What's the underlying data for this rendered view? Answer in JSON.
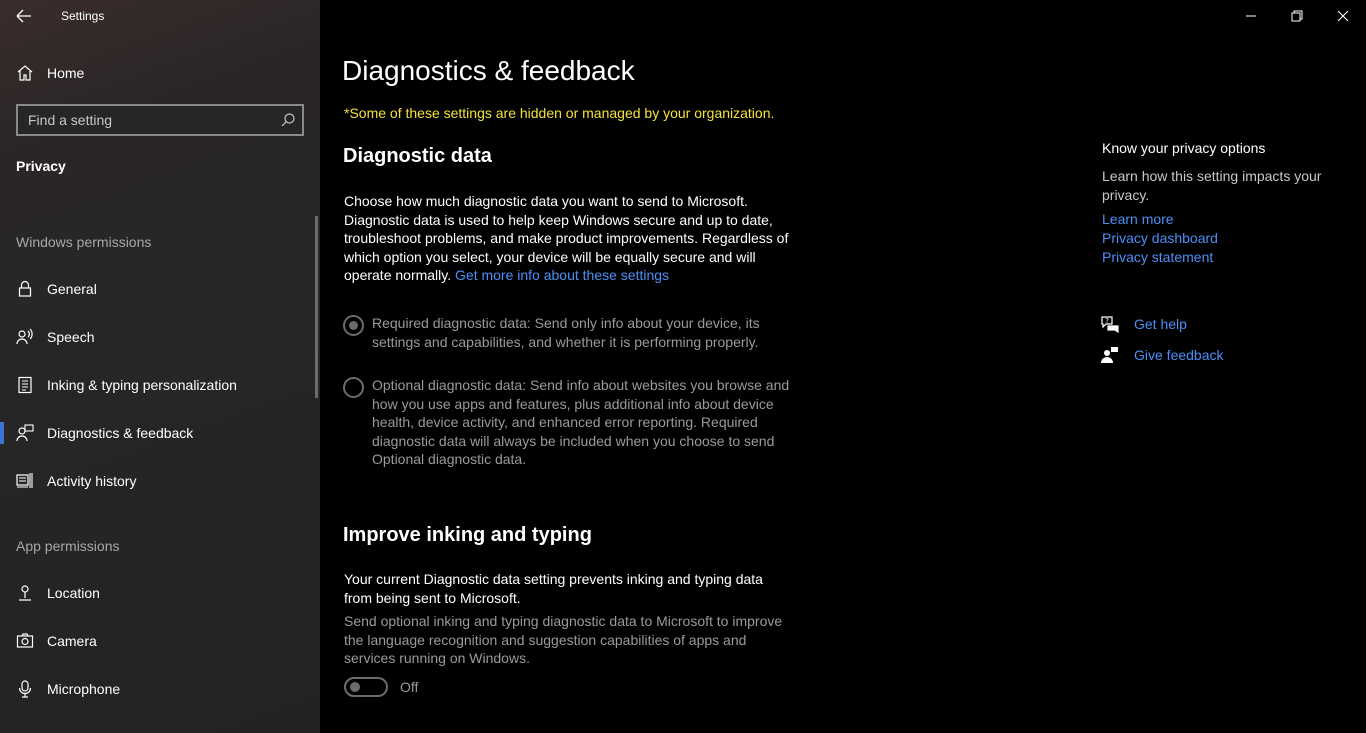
{
  "window": {
    "app_title": "Settings"
  },
  "sidebar": {
    "home_label": "Home",
    "search_placeholder": "Find a setting",
    "section": "Privacy",
    "windows_permissions_label": "Windows permissions",
    "windows_items": [
      {
        "label": "General",
        "icon": "lock-icon"
      },
      {
        "label": "Speech",
        "icon": "speech-icon"
      },
      {
        "label": "Inking & typing personalization",
        "icon": "inking-icon"
      },
      {
        "label": "Diagnostics & feedback",
        "icon": "diagnostics-icon",
        "active": true
      },
      {
        "label": "Activity history",
        "icon": "activity-icon"
      }
    ],
    "app_permissions_label": "App permissions",
    "app_items": [
      {
        "label": "Location",
        "icon": "location-icon"
      },
      {
        "label": "Camera",
        "icon": "camera-icon"
      },
      {
        "label": "Microphone",
        "icon": "microphone-icon"
      }
    ]
  },
  "main": {
    "title": "Diagnostics & feedback",
    "org_notice": "*Some of these settings are hidden or managed by your organization.",
    "diagnostic": {
      "heading": "Diagnostic data",
      "description": "Choose how much diagnostic data you want to send to Microsoft. Diagnostic data is used to help keep Windows secure and up to date, troubleshoot problems, and make product improvements. Regardless of which option you select, your device will be equally secure and will operate normally.",
      "more_info_link": "Get more info about these settings",
      "required_option": "Required diagnostic data: Send only info about your device, its settings and capabilities, and whether it is performing properly.",
      "optional_option": "Optional diagnostic data: Send info about websites you browse and how you use apps and features, plus additional info about device health, device activity, and enhanced error reporting. Required diagnostic data will always be included when you choose to send Optional diagnostic data.",
      "selected": "required"
    },
    "inking": {
      "heading": "Improve inking and typing",
      "warning": "Your current Diagnostic data setting prevents inking and typing data from being sent to Microsoft.",
      "description": "Send optional inking and typing diagnostic data to Microsoft to improve the language recognition and suggestion capabilities of apps and services running on Windows.",
      "toggle_state": "Off"
    }
  },
  "right_panel": {
    "title": "Know your privacy options",
    "description": "Learn how this setting impacts your privacy.",
    "links": [
      "Learn more",
      "Privacy dashboard",
      "Privacy statement"
    ],
    "get_help": "Get help",
    "give_feedback": "Give feedback"
  },
  "colors": {
    "accent": "#3a73d6",
    "link": "#4c8ff5",
    "warning": "#f6e33a"
  }
}
